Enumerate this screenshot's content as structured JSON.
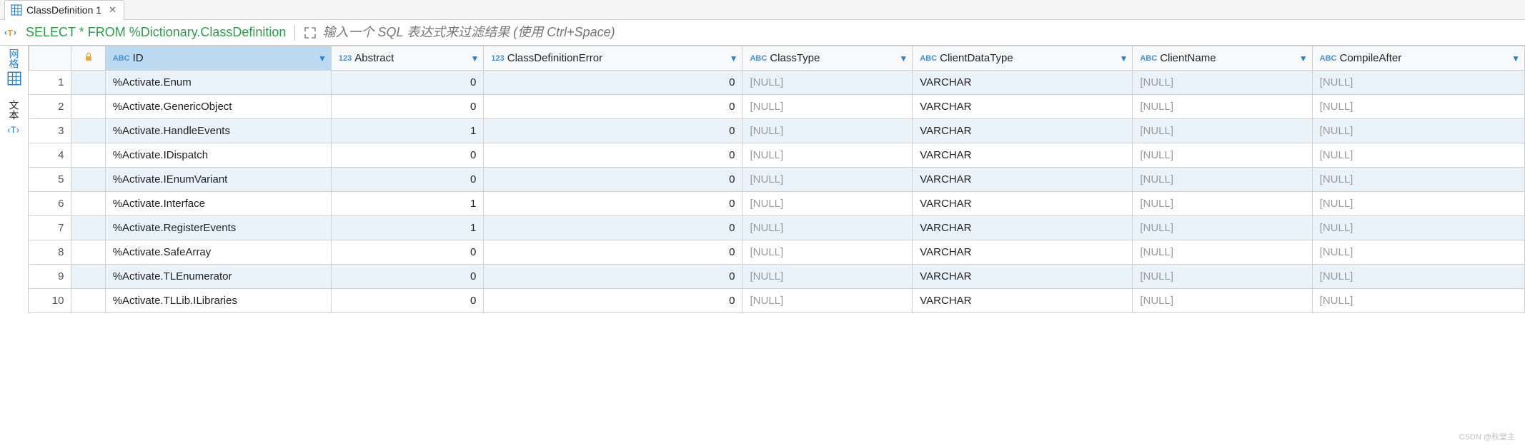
{
  "tab": {
    "title": "ClassDefinition 1",
    "close": "✕"
  },
  "query": "SELECT * FROM %Dictionary.ClassDefinition",
  "filter_placeholder": "输入一个 SQL 表达式来过滤结果 (使用 Ctrl+Space)",
  "side": {
    "grid": "网格",
    "text": "文本"
  },
  "columns": [
    {
      "type": "abc",
      "label": "ID",
      "selected": true
    },
    {
      "type": "num",
      "label": "Abstract"
    },
    {
      "type": "num",
      "label": "ClassDefinitionError"
    },
    {
      "type": "abc",
      "label": "ClassType"
    },
    {
      "type": "abc",
      "label": "ClientDataType"
    },
    {
      "type": "abc",
      "label": "ClientName"
    },
    {
      "type": "abc",
      "label": "CompileAfter"
    }
  ],
  "rows": [
    {
      "n": "1",
      "ID": "%Activate.Enum",
      "Abstract": "0",
      "ClassDefinitionError": "0",
      "ClassType": "[NULL]",
      "ClientDataType": "VARCHAR",
      "ClientName": "[NULL]",
      "CompileAfter": "[NULL]"
    },
    {
      "n": "2",
      "ID": "%Activate.GenericObject",
      "Abstract": "0",
      "ClassDefinitionError": "0",
      "ClassType": "[NULL]",
      "ClientDataType": "VARCHAR",
      "ClientName": "[NULL]",
      "CompileAfter": "[NULL]"
    },
    {
      "n": "3",
      "ID": "%Activate.HandleEvents",
      "Abstract": "1",
      "ClassDefinitionError": "0",
      "ClassType": "[NULL]",
      "ClientDataType": "VARCHAR",
      "ClientName": "[NULL]",
      "CompileAfter": "[NULL]"
    },
    {
      "n": "4",
      "ID": "%Activate.IDispatch",
      "Abstract": "0",
      "ClassDefinitionError": "0",
      "ClassType": "[NULL]",
      "ClientDataType": "VARCHAR",
      "ClientName": "[NULL]",
      "CompileAfter": "[NULL]"
    },
    {
      "n": "5",
      "ID": "%Activate.IEnumVariant",
      "Abstract": "0",
      "ClassDefinitionError": "0",
      "ClassType": "[NULL]",
      "ClientDataType": "VARCHAR",
      "ClientName": "[NULL]",
      "CompileAfter": "[NULL]"
    },
    {
      "n": "6",
      "ID": "%Activate.Interface",
      "Abstract": "1",
      "ClassDefinitionError": "0",
      "ClassType": "[NULL]",
      "ClientDataType": "VARCHAR",
      "ClientName": "[NULL]",
      "CompileAfter": "[NULL]"
    },
    {
      "n": "7",
      "ID": "%Activate.RegisterEvents",
      "Abstract": "1",
      "ClassDefinitionError": "0",
      "ClassType": "[NULL]",
      "ClientDataType": "VARCHAR",
      "ClientName": "[NULL]",
      "CompileAfter": "[NULL]"
    },
    {
      "n": "8",
      "ID": "%Activate.SafeArray",
      "Abstract": "0",
      "ClassDefinitionError": "0",
      "ClassType": "[NULL]",
      "ClientDataType": "VARCHAR",
      "ClientName": "[NULL]",
      "CompileAfter": "[NULL]"
    },
    {
      "n": "9",
      "ID": "%Activate.TLEnumerator",
      "Abstract": "0",
      "ClassDefinitionError": "0",
      "ClassType": "[NULL]",
      "ClientDataType": "VARCHAR",
      "ClientName": "[NULL]",
      "CompileAfter": "[NULL]"
    },
    {
      "n": "10",
      "ID": "%Activate.TLLib.ILibraries",
      "Abstract": "0",
      "ClassDefinitionError": "0",
      "ClassType": "[NULL]",
      "ClientDataType": "VARCHAR",
      "ClientName": "[NULL]",
      "CompileAfter": "[NULL]"
    }
  ],
  "watermark": "CSDN @秋堂主",
  "colwidths": {
    "rownum": 44,
    "lock": 34,
    "ID": 234,
    "Abstract": 158,
    "ClassDefinitionError": 268,
    "ClassType": 176,
    "ClientDataType": 228,
    "ClientName": 186,
    "CompileAfter": 220
  }
}
